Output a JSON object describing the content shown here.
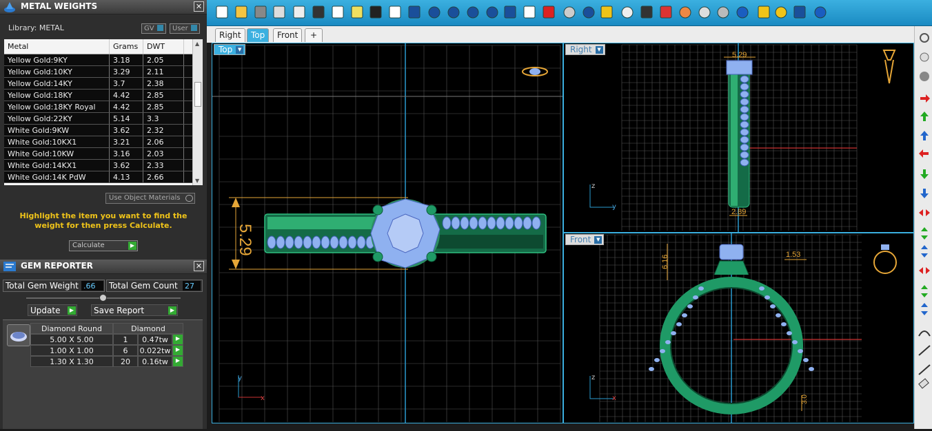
{
  "metal_panel": {
    "title": "METAL WEIGHTS",
    "library_label": "Library: METAL",
    "toggle_gv": "GV",
    "toggle_user": "User",
    "columns": [
      "Metal",
      "Grams",
      "DWT"
    ],
    "rows": [
      [
        "Yellow Gold:9KY",
        "3.18",
        "2.05"
      ],
      [
        "Yellow Gold:10KY",
        "3.29",
        "2.11"
      ],
      [
        "Yellow Gold:14KY",
        "3.7",
        "2.38"
      ],
      [
        "Yellow Gold:18KY",
        "4.42",
        "2.85"
      ],
      [
        "Yellow Gold:18KY Royal",
        "4.42",
        "2.85"
      ],
      [
        "Yellow Gold:22KY",
        "5.14",
        "3.3"
      ],
      [
        "White Gold:9KW",
        "3.62",
        "2.32"
      ],
      [
        "White Gold:10KX1",
        "3.21",
        "2.06"
      ],
      [
        "White Gold:10KW",
        "3.16",
        "2.03"
      ],
      [
        "White Gold:14KX1",
        "3.62",
        "2.33"
      ],
      [
        "White Gold:14K PdW",
        "4.13",
        "2.66"
      ]
    ],
    "use_object_materials": "Use Object Materials",
    "hint": "Highlight the item you want to find the weight for then press Calculate.",
    "calculate_label": "Calculate"
  },
  "gem_panel": {
    "title": "GEM REPORTER",
    "total_weight_label": "Total Gem Weight",
    "total_weight_value": ".66",
    "total_count_label": "Total Gem Count",
    "total_count_value": "27",
    "update_label": "Update",
    "save_report_label": "Save Report",
    "table_headers": [
      "Diamond Round",
      "Diamond"
    ],
    "table_rows": [
      [
        "5.00 X 5.00",
        "1",
        "0.47tw"
      ],
      [
        "1.00 X 1.00",
        "6",
        "0.022tw"
      ],
      [
        "1.30 X 1.30",
        "20",
        "0.16tw"
      ]
    ]
  },
  "view_tabs": [
    "Right",
    "Top",
    "Front"
  ],
  "active_tab": "Top",
  "viewports": {
    "top": {
      "label": "Top",
      "dimension": "5.29"
    },
    "right": {
      "label": "Right",
      "dim_top": "5.29",
      "dim_bottom": "2.89"
    },
    "front": {
      "label": "Front",
      "dim_left": "6.16",
      "dim_right": "1.53",
      "dim_bottom": "3.0"
    }
  },
  "axis_labels": {
    "x": "x",
    "y": "y",
    "z": "z"
  },
  "toolbar_icons": [
    "new-icon",
    "open-icon",
    "save-icon",
    "print-icon",
    "export-icon",
    "cut-icon",
    "copy-icon",
    "paste-icon",
    "undo-icon",
    "pan-icon",
    "move-icon",
    "zoom-in-icon",
    "zoom-window-icon",
    "zoom-extents-icon",
    "zoom-selected-icon",
    "rotate-view-icon",
    "four-views-icon",
    "car-icon",
    "eye-icon",
    "target-icon",
    "snap-icon",
    "lightbulb-icon",
    "lock-icon",
    "book-icon",
    "color-wheel-icon",
    "sphere-shaded-icon",
    "sphere-render-icon",
    "sphere-blue-icon",
    "pencil-icon",
    "settings-gear-icon",
    "dimension-icon",
    "help-icon"
  ],
  "colors": {
    "accent": "#3bb0e0",
    "gold_text": "#f0c419",
    "ring_green": "#1f9a66",
    "gem_blue": "#8fb1f0",
    "dimension": "#e6a637"
  }
}
